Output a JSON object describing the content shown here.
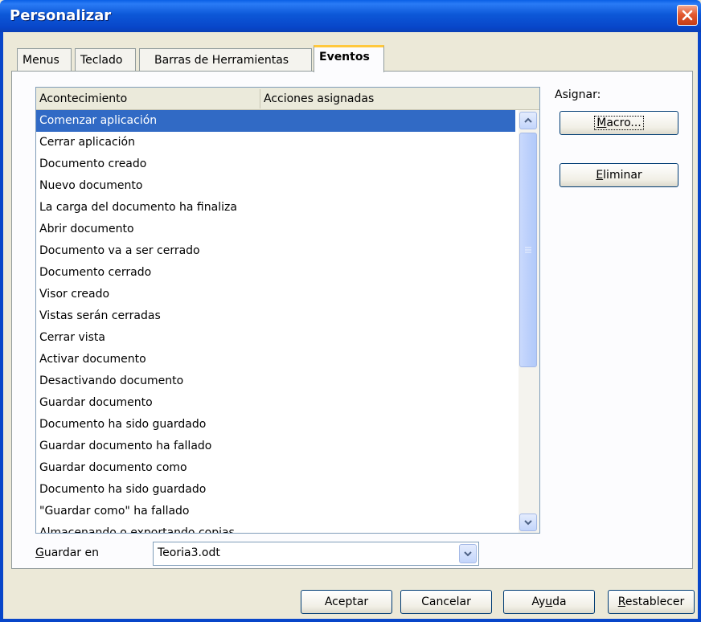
{
  "window": {
    "title": "Personalizar"
  },
  "tabs": [
    {
      "label": "Menus",
      "active": false
    },
    {
      "label": "Teclado",
      "active": false
    },
    {
      "label": "Barras de Herramientas",
      "active": false
    },
    {
      "label": "Eventos",
      "active": true
    }
  ],
  "events_list": {
    "columns": [
      "Acontecimiento",
      "Acciones asignadas"
    ],
    "selected_index": 0,
    "rows": [
      "Comenzar aplicación",
      "Cerrar aplicación",
      "Documento creado",
      "Nuevo documento",
      "La carga del documento ha finaliza",
      "Abrir documento",
      "Documento va a ser cerrado",
      "Documento cerrado",
      "Visor creado",
      "Vistas serán cerradas",
      "Cerrar vista",
      "Activar documento",
      "Desactivando documento",
      "Guardar documento",
      "Documento ha sido guardado",
      "Guardar documento ha fallado",
      "Guardar documento como",
      "Documento ha sido guardado",
      "\"Guardar como\" ha fallado",
      "Almacenando o exportando copias"
    ]
  },
  "assign": {
    "label": "Asignar:",
    "macro_button": {
      "prefix": "",
      "mnemonic": "M",
      "rest": "acro..."
    },
    "delete_button": {
      "prefix": "",
      "mnemonic": "E",
      "rest": "liminar"
    }
  },
  "save_in": {
    "label_mnemonic": "G",
    "label_rest": "uardar en",
    "value": "Teoria3.odt"
  },
  "footer_buttons": {
    "accept": "Aceptar",
    "cancel": "Cancelar",
    "help": {
      "prefix": "Ay",
      "mnemonic": "u",
      "rest": "da"
    },
    "reset": {
      "prefix": "",
      "mnemonic": "R",
      "rest": "establecer"
    }
  },
  "colors": {
    "selection": "#316ac5",
    "titlebar": "#0846c9",
    "active_tab_accent": "#ffc83c",
    "dialog_bg": "#ece9d8"
  },
  "icons": {
    "close": "close-icon",
    "scroll_up": "chevron-up-icon",
    "scroll_down": "chevron-down-icon",
    "combo_dropdown": "chevron-down-icon"
  }
}
